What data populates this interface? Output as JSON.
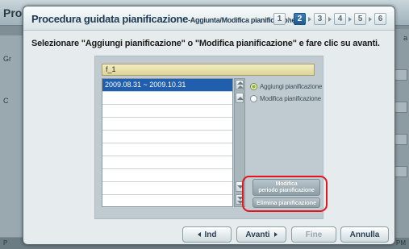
{
  "background": {
    "title_fragment": "Pro",
    "left_label": "Gr",
    "left_label2": "C",
    "right_label": "a",
    "bottom_left": "P",
    "bottom_right": "PM"
  },
  "dialog": {
    "title": "Procedura guidata pianificazione",
    "subtitle": "-Aggiunta/Modifica pianificazione",
    "steps": [
      "1",
      "2",
      "3",
      "4",
      "5",
      "6"
    ],
    "active_step": "2",
    "instruction": "Selezionare \"Aggiungi pianificazione\" o \"Modifica pianificazione\" e fare clic su avanti."
  },
  "schedule": {
    "name": "f_1",
    "periods": [
      "2009.08.31 ~ 2009.10.31"
    ],
    "selected_index": 0
  },
  "options": {
    "add_label": "Aggiungi pianificazione",
    "modify_label": "Modifica pianificazione",
    "selected": "add"
  },
  "actions": {
    "modify_period_line1": "Modifica",
    "modify_period_line2": "periodo pianificazione",
    "delete_label": "Elimina pianificazione"
  },
  "footer": {
    "back_label": "Ind",
    "next_label": "Avanti",
    "finish_label": "Fine",
    "cancel_label": "Annulla"
  },
  "colors": {
    "highlight": "#e5141d",
    "selected_row": "#1f5fae",
    "active_step": "#2a6aa2"
  }
}
